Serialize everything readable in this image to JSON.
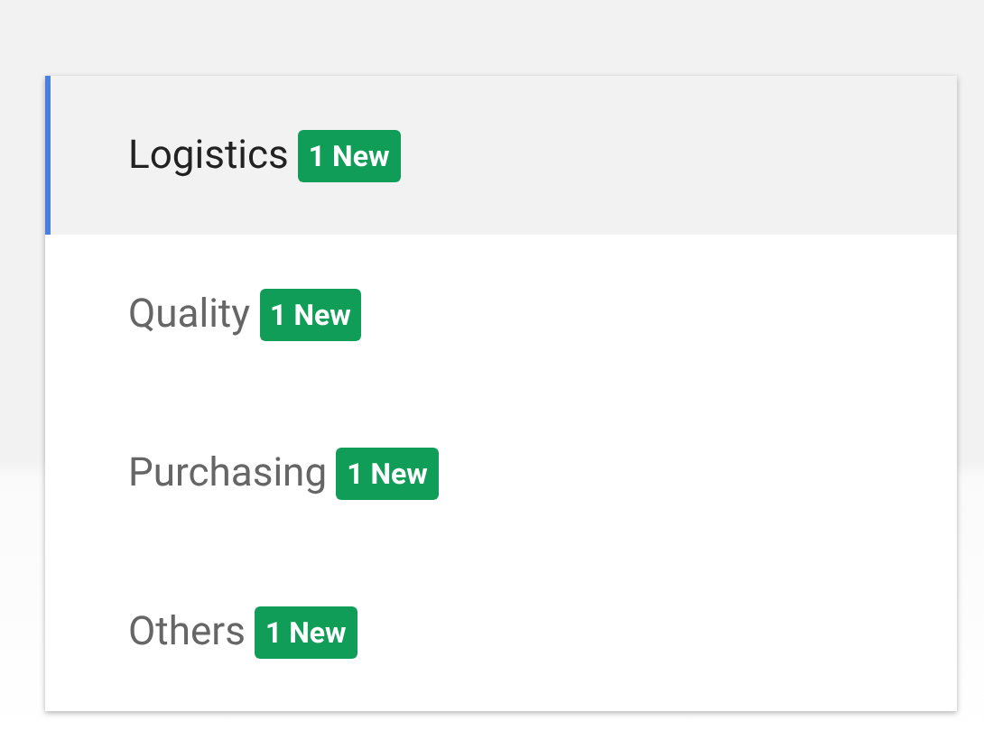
{
  "items": [
    {
      "label": "Logistics",
      "badge": "1 New",
      "selected": true
    },
    {
      "label": "Quality",
      "badge": "1 New",
      "selected": false
    },
    {
      "label": "Purchasing",
      "badge": "1 New",
      "selected": false
    },
    {
      "label": "Others",
      "badge": "1 New",
      "selected": false
    }
  ]
}
